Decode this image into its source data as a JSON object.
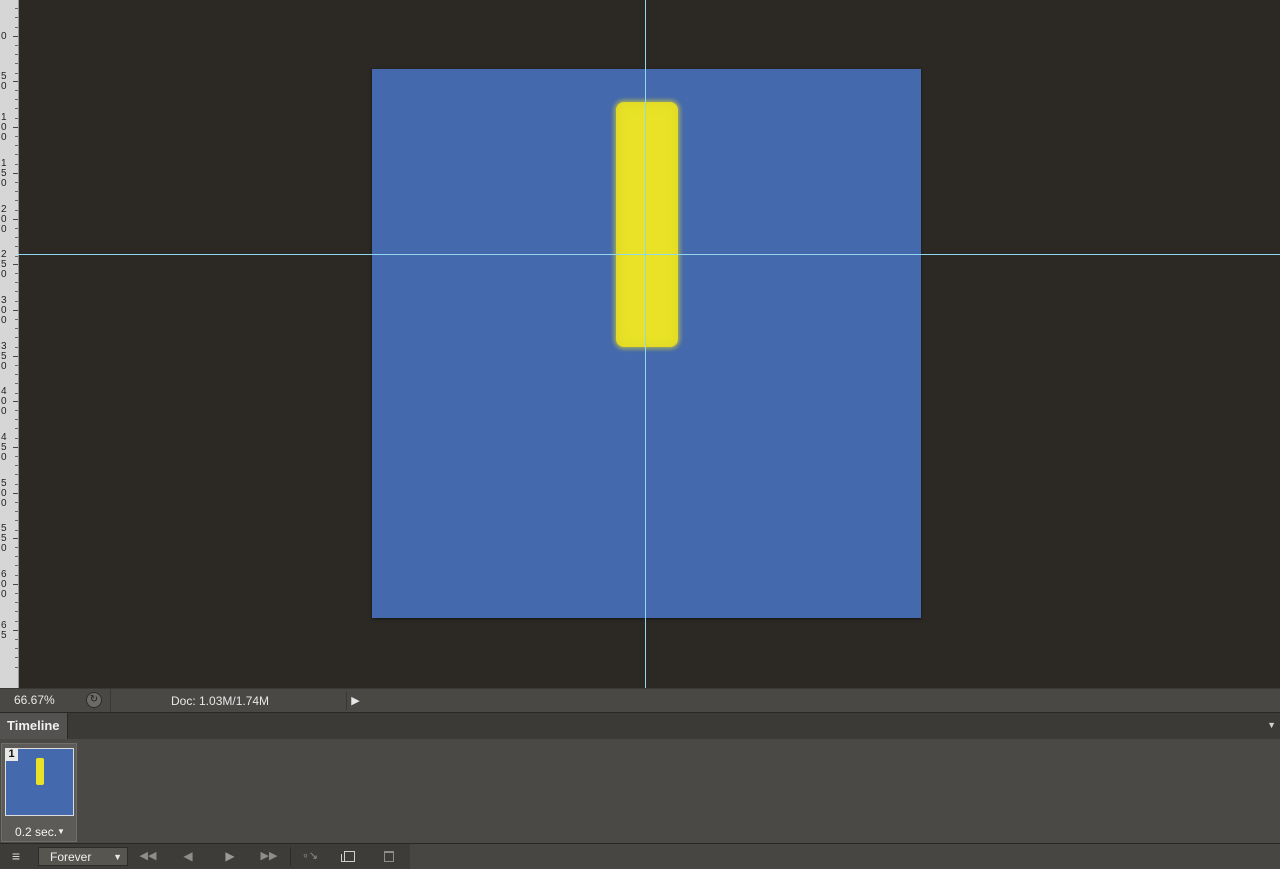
{
  "ruler": {
    "labels": [
      "5\n0",
      "0",
      "5\n0",
      "1\n0\n0",
      "1\n5\n0",
      "2\n0\n0",
      "2\n5\n0",
      "3\n0\n0",
      "3\n5\n0",
      "4\n0\n0",
      "4\n5\n0",
      "5\n0\n0",
      "5\n5\n0",
      "6\n0\n0",
      "6\n5"
    ]
  },
  "colors": {
    "document_fill": "#4469ad",
    "brush_stroke": "#e9e226",
    "guide": "#8fd8f0",
    "workspace": "#2c2925"
  },
  "status": {
    "zoom": "66.67%",
    "doc_info": "Doc: 1.03M/1.74M",
    "menu_arrow_icon": "triangle-right-icon",
    "proof_icon": "export-icon"
  },
  "timeline": {
    "tab_label": "Timeline",
    "frames": [
      {
        "number": "1",
        "delay": "0.2 sec."
      }
    ],
    "loop_option": "Forever",
    "controls": [
      "convert-timeline-icon",
      "first-frame-icon",
      "previous-frame-icon",
      "play-icon",
      "next-frame-icon",
      "tween-icon",
      "duplicate-frame-icon",
      "delete-frame-icon"
    ]
  }
}
